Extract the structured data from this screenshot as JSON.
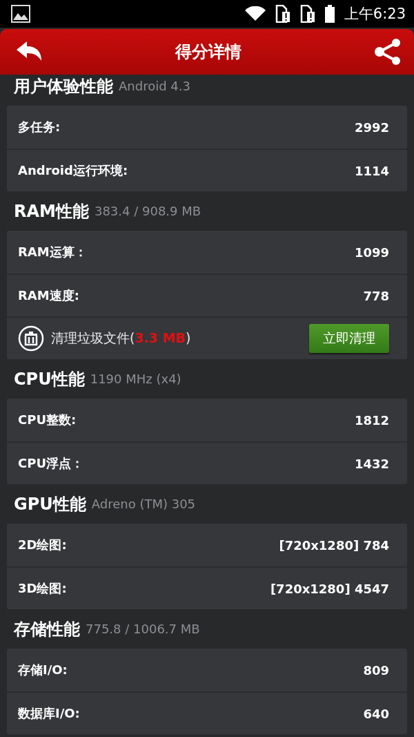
{
  "status_bar": {
    "time": "上午6:23"
  },
  "header": {
    "title": "得分详情"
  },
  "sections": [
    {
      "title": "用户体验性能",
      "subtitle": "Android 4.3",
      "rows": [
        {
          "label": "多任务:",
          "value": "2992"
        },
        {
          "label": "Android运行环境:",
          "value": "1114"
        }
      ]
    },
    {
      "title": "RAM性能",
      "subtitle": "383.4 / 908.9 MB",
      "rows": [
        {
          "label": "RAM运算：",
          "value": "1099"
        },
        {
          "label": "RAM速度:",
          "value": "778"
        }
      ],
      "cleanup": {
        "label": "清理垃圾文件(",
        "size": "3.3 MB",
        "close": ")",
        "button": "立即清理"
      }
    },
    {
      "title": "CPU性能",
      "subtitle": "1190 MHz (x4)",
      "rows": [
        {
          "label": "CPU整数:",
          "value": "1812"
        },
        {
          "label": "CPU浮点：",
          "value": "1432"
        }
      ]
    },
    {
      "title": "GPU性能",
      "subtitle": "Adreno (TM) 305",
      "rows": [
        {
          "label": "2D绘图:",
          "value": "[720x1280] 784"
        },
        {
          "label": "3D绘图:",
          "value": "[720x1280] 4547"
        }
      ]
    },
    {
      "title": "存储性能",
      "subtitle": "775.8 / 1006.7 MB",
      "rows": [
        {
          "label": "存储I/O:",
          "value": "809"
        },
        {
          "label": "数据库I/O:",
          "value": "640"
        }
      ]
    }
  ]
}
